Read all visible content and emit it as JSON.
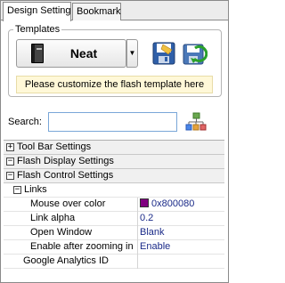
{
  "tabs": [
    {
      "label": "Design Setting",
      "active": true
    },
    {
      "label": "Bookmark",
      "active": false
    }
  ],
  "templates": {
    "group_label": "Templates",
    "selected_template": "Neat",
    "hint": "Please customize the flash template here"
  },
  "search": {
    "label": "Search:",
    "value": ""
  },
  "properties": {
    "toolbar_settings": "Tool Bar Settings",
    "flash_display_settings": "Flash Display Settings",
    "flash_control_settings": "Flash Control Settings",
    "links": "Links",
    "mouse_over_color": {
      "label": "Mouse over color",
      "value": "0x800080",
      "swatch": "#800080"
    },
    "link_alpha": {
      "label": "Link alpha",
      "value": "0.2"
    },
    "open_window": {
      "label": "Open Window",
      "value": "Blank"
    },
    "enable_after_zooming": {
      "label": "Enable after zooming in",
      "value": "Enable"
    },
    "google_analytics_id": {
      "label": "Google Analytics ID",
      "value": ""
    }
  }
}
